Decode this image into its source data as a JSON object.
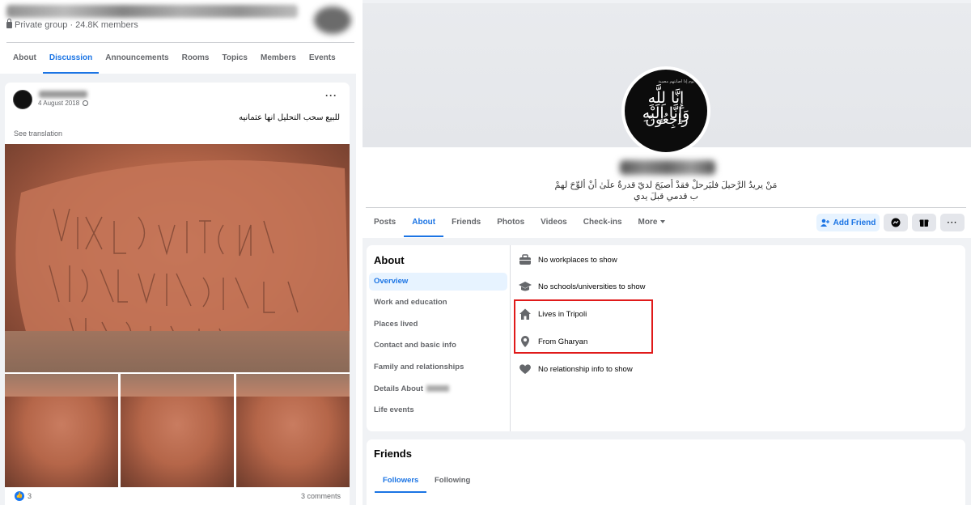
{
  "group": {
    "privacy": "Private group",
    "members": "24.8K members",
    "tabs": [
      "About",
      "Discussion",
      "Announcements",
      "Rooms",
      "Topics",
      "Members",
      "Events"
    ],
    "active_tab": "Discussion"
  },
  "post": {
    "date": "4 August 2018",
    "more": "···",
    "text": "للبيع سحب التحليل انها عثمانيه",
    "see_translation": "See translation",
    "reactions_count": "3",
    "comments": "3 comments"
  },
  "profile": {
    "avatar_top_text": "يوم إذا أصابتهم مصيبة",
    "avatar_line1": "إِنَّا لِلَّهِ وَإِنَّا إِلَيْهِ",
    "avatar_line2": "رَاجِعُونَ",
    "bio_line1": "مَنْ يريدُ الرَّحيلَ فليَرحلْ فقدْ أصبَحَ لديّ قدرةٌ علَىٰ أنْ ألوِّحَ لهمْ",
    "bio_line2": "ب قدمي قبلَ يدي",
    "tabs": [
      "Posts",
      "About",
      "Friends",
      "Photos",
      "Videos",
      "Check-ins",
      "More"
    ],
    "active_tab": "About",
    "add_friend": "Add Friend"
  },
  "about": {
    "title": "About",
    "nav": [
      "Overview",
      "Work and education",
      "Places lived",
      "Contact and basic info",
      "Family and relationships",
      "Details About",
      "Life events"
    ],
    "active_nav": "Overview",
    "rows": [
      {
        "icon": "briefcase-icon",
        "text": "No workplaces to show"
      },
      {
        "icon": "graduation-cap-icon",
        "text": "No schools/universities to show"
      },
      {
        "icon": "home-icon",
        "text": "Lives in Tripoli"
      },
      {
        "icon": "location-pin-icon",
        "text": "From Gharyan"
      },
      {
        "icon": "heart-icon",
        "text": "No relationship info to show"
      }
    ]
  },
  "friends": {
    "title": "Friends",
    "tabs": [
      "Followers",
      "Following"
    ],
    "active_tab": "Followers"
  },
  "colors": {
    "accent": "#1b74e4",
    "highlight": "#e01a1a",
    "background": "#f0f2f5"
  }
}
